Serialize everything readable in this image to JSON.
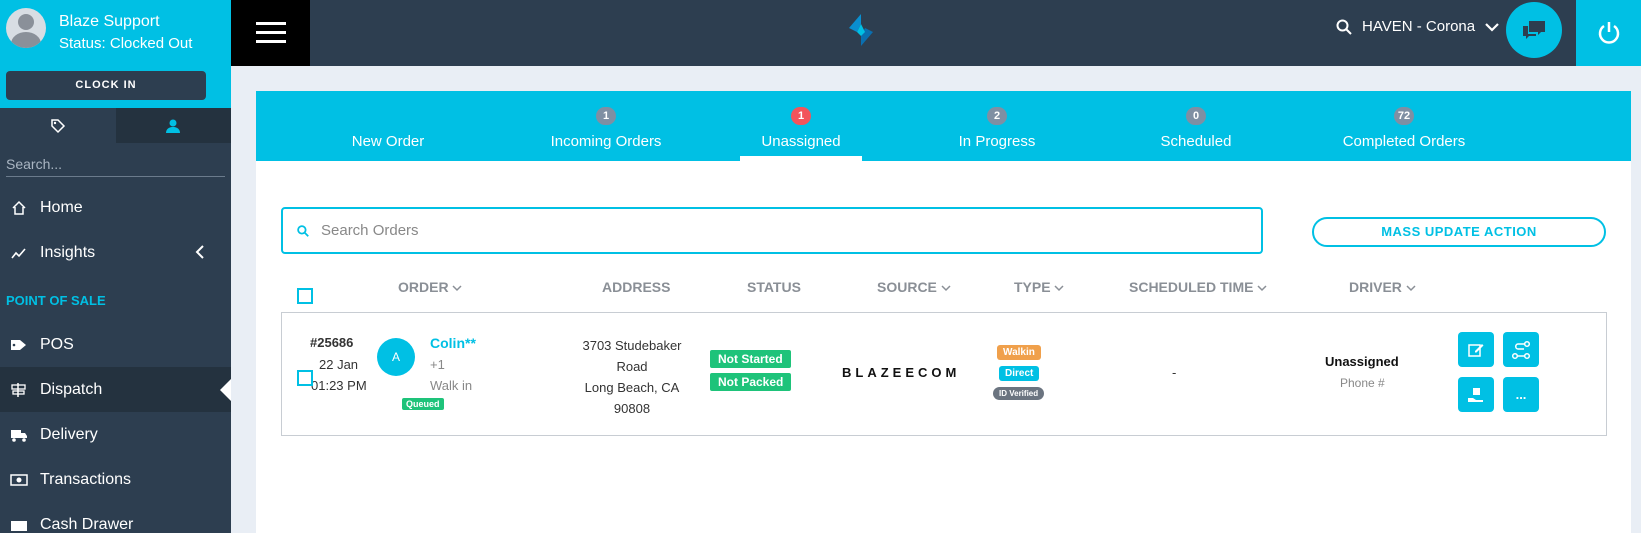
{
  "sidebar": {
    "user_name": "Blaze Support",
    "status": "Status: Clocked Out",
    "clock_in_label": "CLOCK IN",
    "search_placeholder": "Search...",
    "items": [
      {
        "label": "Home",
        "icon": "home-icon"
      },
      {
        "label": "Insights",
        "icon": "insights-icon"
      }
    ],
    "section_title": "POINT OF SALE",
    "pos_items": [
      {
        "label": "POS",
        "icon": "tag-icon"
      },
      {
        "label": "Dispatch",
        "icon": "signpost-icon"
      },
      {
        "label": "Delivery",
        "icon": "truck-icon"
      },
      {
        "label": "Transactions",
        "icon": "money-icon"
      },
      {
        "label": "Cash Drawer",
        "icon": "drawer-icon"
      }
    ]
  },
  "topbar": {
    "location": "HAVEN - Corona"
  },
  "tabs": [
    {
      "label": "New Order",
      "count": ""
    },
    {
      "label": "Incoming Orders",
      "count": "1"
    },
    {
      "label": "Unassigned",
      "count": "1"
    },
    {
      "label": "In Progress",
      "count": "2"
    },
    {
      "label": "Scheduled",
      "count": "0"
    },
    {
      "label": "Completed Orders",
      "count": "72"
    }
  ],
  "search": {
    "placeholder": "Search Orders"
  },
  "mass_update_label": "MASS UPDATE ACTION",
  "columns": {
    "order": "ORDER",
    "address": "ADDRESS",
    "status": "STATUS",
    "source": "SOURCE",
    "type": "TYPE",
    "scheduled_time": "SCHEDULED TIME",
    "driver": "DRIVER"
  },
  "order": {
    "number": "#25686",
    "date": "22 Jan",
    "time": "01:23 PM",
    "customer_initial": "A",
    "customer_name": "Colin**",
    "customer_phone": "+1",
    "customer_mode": "Walk in",
    "queue_badge": "Queued",
    "address_lines": [
      "3703 Studebaker",
      "Road",
      "Long Beach, CA",
      "90808"
    ],
    "status_1": "Not Started",
    "status_2": "Not Packed",
    "source": "BLAZEECOM",
    "type_1": "Walkin",
    "type_2": "Direct",
    "type_3": "ID Verified",
    "scheduled_time": "-",
    "driver": "Unassigned",
    "driver_phone": "Phone #"
  },
  "colors": {
    "accent": "#00c0e4",
    "dark": "#2d3e50",
    "green": "#1ec37a",
    "orange": "#f0a04b",
    "red_badge": "#f2545b"
  }
}
